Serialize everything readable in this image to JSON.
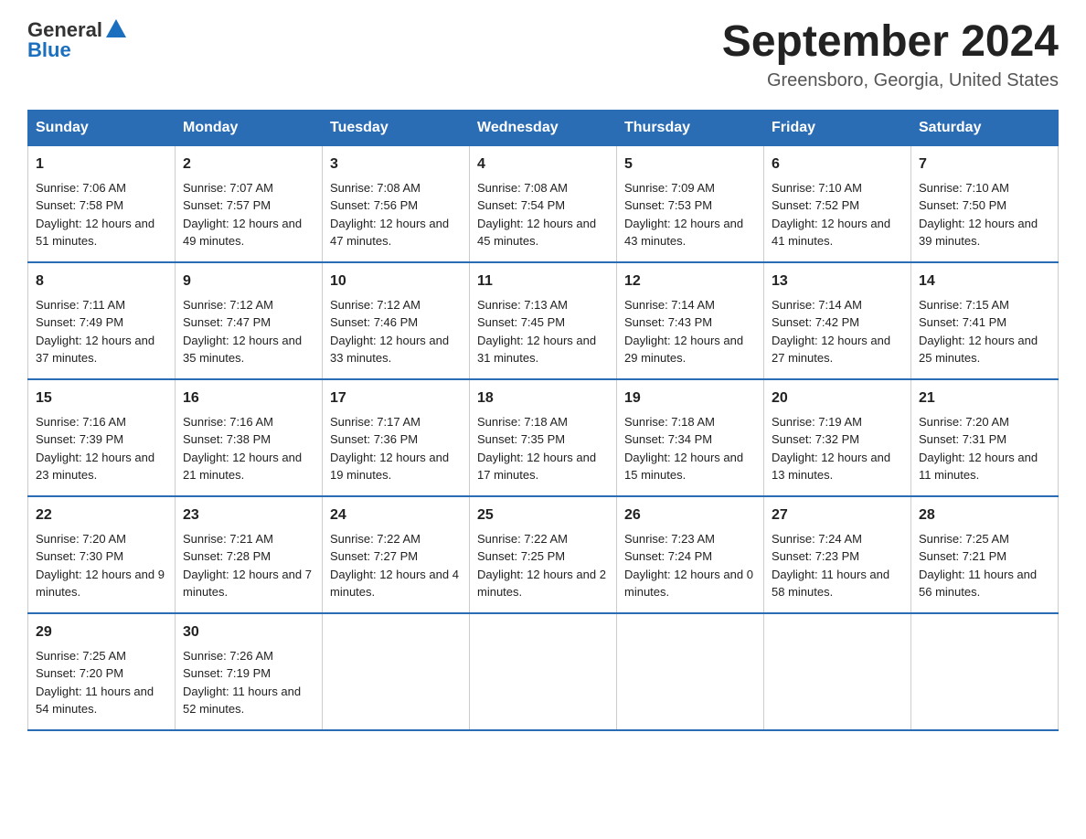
{
  "header": {
    "logo": {
      "general": "General",
      "blue": "Blue"
    },
    "title": "September 2024",
    "location": "Greensboro, Georgia, United States"
  },
  "weekdays": [
    "Sunday",
    "Monday",
    "Tuesday",
    "Wednesday",
    "Thursday",
    "Friday",
    "Saturday"
  ],
  "weeks": [
    [
      {
        "day": "1",
        "sunrise": "Sunrise: 7:06 AM",
        "sunset": "Sunset: 7:58 PM",
        "daylight": "Daylight: 12 hours and 51 minutes."
      },
      {
        "day": "2",
        "sunrise": "Sunrise: 7:07 AM",
        "sunset": "Sunset: 7:57 PM",
        "daylight": "Daylight: 12 hours and 49 minutes."
      },
      {
        "day": "3",
        "sunrise": "Sunrise: 7:08 AM",
        "sunset": "Sunset: 7:56 PM",
        "daylight": "Daylight: 12 hours and 47 minutes."
      },
      {
        "day": "4",
        "sunrise": "Sunrise: 7:08 AM",
        "sunset": "Sunset: 7:54 PM",
        "daylight": "Daylight: 12 hours and 45 minutes."
      },
      {
        "day": "5",
        "sunrise": "Sunrise: 7:09 AM",
        "sunset": "Sunset: 7:53 PM",
        "daylight": "Daylight: 12 hours and 43 minutes."
      },
      {
        "day": "6",
        "sunrise": "Sunrise: 7:10 AM",
        "sunset": "Sunset: 7:52 PM",
        "daylight": "Daylight: 12 hours and 41 minutes."
      },
      {
        "day": "7",
        "sunrise": "Sunrise: 7:10 AM",
        "sunset": "Sunset: 7:50 PM",
        "daylight": "Daylight: 12 hours and 39 minutes."
      }
    ],
    [
      {
        "day": "8",
        "sunrise": "Sunrise: 7:11 AM",
        "sunset": "Sunset: 7:49 PM",
        "daylight": "Daylight: 12 hours and 37 minutes."
      },
      {
        "day": "9",
        "sunrise": "Sunrise: 7:12 AM",
        "sunset": "Sunset: 7:47 PM",
        "daylight": "Daylight: 12 hours and 35 minutes."
      },
      {
        "day": "10",
        "sunrise": "Sunrise: 7:12 AM",
        "sunset": "Sunset: 7:46 PM",
        "daylight": "Daylight: 12 hours and 33 minutes."
      },
      {
        "day": "11",
        "sunrise": "Sunrise: 7:13 AM",
        "sunset": "Sunset: 7:45 PM",
        "daylight": "Daylight: 12 hours and 31 minutes."
      },
      {
        "day": "12",
        "sunrise": "Sunrise: 7:14 AM",
        "sunset": "Sunset: 7:43 PM",
        "daylight": "Daylight: 12 hours and 29 minutes."
      },
      {
        "day": "13",
        "sunrise": "Sunrise: 7:14 AM",
        "sunset": "Sunset: 7:42 PM",
        "daylight": "Daylight: 12 hours and 27 minutes."
      },
      {
        "day": "14",
        "sunrise": "Sunrise: 7:15 AM",
        "sunset": "Sunset: 7:41 PM",
        "daylight": "Daylight: 12 hours and 25 minutes."
      }
    ],
    [
      {
        "day": "15",
        "sunrise": "Sunrise: 7:16 AM",
        "sunset": "Sunset: 7:39 PM",
        "daylight": "Daylight: 12 hours and 23 minutes."
      },
      {
        "day": "16",
        "sunrise": "Sunrise: 7:16 AM",
        "sunset": "Sunset: 7:38 PM",
        "daylight": "Daylight: 12 hours and 21 minutes."
      },
      {
        "day": "17",
        "sunrise": "Sunrise: 7:17 AM",
        "sunset": "Sunset: 7:36 PM",
        "daylight": "Daylight: 12 hours and 19 minutes."
      },
      {
        "day": "18",
        "sunrise": "Sunrise: 7:18 AM",
        "sunset": "Sunset: 7:35 PM",
        "daylight": "Daylight: 12 hours and 17 minutes."
      },
      {
        "day": "19",
        "sunrise": "Sunrise: 7:18 AM",
        "sunset": "Sunset: 7:34 PM",
        "daylight": "Daylight: 12 hours and 15 minutes."
      },
      {
        "day": "20",
        "sunrise": "Sunrise: 7:19 AM",
        "sunset": "Sunset: 7:32 PM",
        "daylight": "Daylight: 12 hours and 13 minutes."
      },
      {
        "day": "21",
        "sunrise": "Sunrise: 7:20 AM",
        "sunset": "Sunset: 7:31 PM",
        "daylight": "Daylight: 12 hours and 11 minutes."
      }
    ],
    [
      {
        "day": "22",
        "sunrise": "Sunrise: 7:20 AM",
        "sunset": "Sunset: 7:30 PM",
        "daylight": "Daylight: 12 hours and 9 minutes."
      },
      {
        "day": "23",
        "sunrise": "Sunrise: 7:21 AM",
        "sunset": "Sunset: 7:28 PM",
        "daylight": "Daylight: 12 hours and 7 minutes."
      },
      {
        "day": "24",
        "sunrise": "Sunrise: 7:22 AM",
        "sunset": "Sunset: 7:27 PM",
        "daylight": "Daylight: 12 hours and 4 minutes."
      },
      {
        "day": "25",
        "sunrise": "Sunrise: 7:22 AM",
        "sunset": "Sunset: 7:25 PM",
        "daylight": "Daylight: 12 hours and 2 minutes."
      },
      {
        "day": "26",
        "sunrise": "Sunrise: 7:23 AM",
        "sunset": "Sunset: 7:24 PM",
        "daylight": "Daylight: 12 hours and 0 minutes."
      },
      {
        "day": "27",
        "sunrise": "Sunrise: 7:24 AM",
        "sunset": "Sunset: 7:23 PM",
        "daylight": "Daylight: 11 hours and 58 minutes."
      },
      {
        "day": "28",
        "sunrise": "Sunrise: 7:25 AM",
        "sunset": "Sunset: 7:21 PM",
        "daylight": "Daylight: 11 hours and 56 minutes."
      }
    ],
    [
      {
        "day": "29",
        "sunrise": "Sunrise: 7:25 AM",
        "sunset": "Sunset: 7:20 PM",
        "daylight": "Daylight: 11 hours and 54 minutes."
      },
      {
        "day": "30",
        "sunrise": "Sunrise: 7:26 AM",
        "sunset": "Sunset: 7:19 PM",
        "daylight": "Daylight: 11 hours and 52 minutes."
      },
      null,
      null,
      null,
      null,
      null
    ]
  ]
}
